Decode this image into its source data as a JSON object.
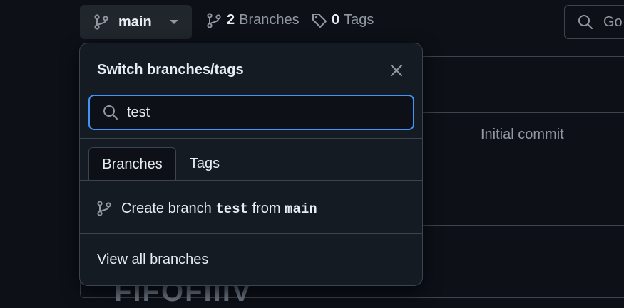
{
  "toolbar": {
    "branch_selector_label": "main",
    "branches_count": "2",
    "branches_label": "Branches",
    "tags_count": "0",
    "tags_label": "Tags",
    "search_placeholder": "Go"
  },
  "background": {
    "commit_message": "Initial commit",
    "heading_partial": "FIFOFIIIV"
  },
  "dropdown": {
    "title": "Switch branches/tags",
    "filter_value": "test",
    "tabs": [
      {
        "label": "Branches",
        "active": true
      },
      {
        "label": "Tags",
        "active": false
      }
    ],
    "create_branch": {
      "prefix": "Create branch",
      "new_branch": "test",
      "middle": "from",
      "source_branch": "main"
    },
    "view_all_label": "View all branches"
  },
  "colors": {
    "background": "#0d1117",
    "overlay": "#151b23",
    "border": "#3d444d",
    "focus": "#4493f8",
    "muted_text": "#9198a1"
  },
  "icons": [
    "git-branch-icon",
    "chevron-down-icon",
    "tag-icon",
    "search-icon",
    "close-icon"
  ]
}
